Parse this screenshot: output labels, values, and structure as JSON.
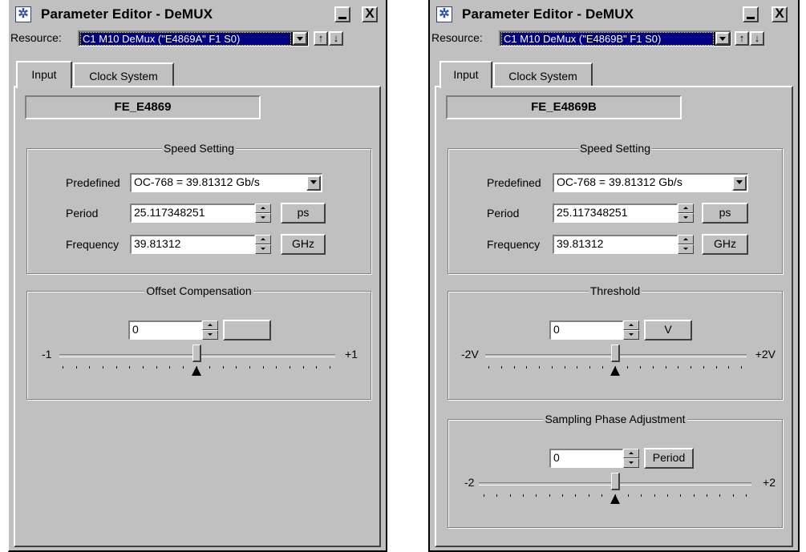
{
  "windows": [
    {
      "title": "Parameter Editor - DeMUX",
      "minimize_label": "",
      "close_label": "X",
      "resource_label": "Resource:",
      "resource_value": "C1 M10 DeMux (\"E4869A\" F1 S0)",
      "nav_up": "↑",
      "nav_down": "↓",
      "tabs": [
        "Input",
        "Clock System"
      ],
      "active_tab": "Input",
      "device_name": "FE_E4869",
      "speed": {
        "title": "Speed Setting",
        "predefined_label": "Predefined",
        "predefined_value": "OC-768 = 39.81312 Gb/s",
        "period_label": "Period",
        "period_value": "25.117348251",
        "period_unit": "ps",
        "frequency_label": "Frequency",
        "frequency_value": "39.81312",
        "frequency_unit": "GHz"
      },
      "sections": [
        {
          "title": "Offset Compensation",
          "value": "0",
          "unit": "",
          "min_label": "-1",
          "max_label": "+1",
          "level": 0.5
        }
      ]
    },
    {
      "title": "Parameter Editor - DeMUX",
      "minimize_label": "",
      "close_label": "X",
      "resource_label": "Resource:",
      "resource_value": "C1 M10 DeMux (\"E4869B\" F1 S0)",
      "nav_up": "↑",
      "nav_down": "↓",
      "tabs": [
        "Input",
        "Clock System"
      ],
      "active_tab": "Input",
      "device_name": "FE_E4869B",
      "speed": {
        "title": "Speed Setting",
        "predefined_label": "Predefined",
        "predefined_value": "OC-768 = 39.81312 Gb/s",
        "period_label": "Period",
        "period_value": "25.117348251",
        "period_unit": "ps",
        "frequency_label": "Frequency",
        "frequency_value": "39.81312",
        "frequency_unit": "GHz"
      },
      "sections": [
        {
          "title": "Threshold",
          "value": "0",
          "unit": "V",
          "min_label": "-2V",
          "max_label": "+2V",
          "level": 0.5
        },
        {
          "title": "Sampling Phase Adjustment",
          "value": "0",
          "unit": "Period",
          "min_label": "-2",
          "max_label": "+2",
          "level": 0.5
        }
      ]
    }
  ]
}
